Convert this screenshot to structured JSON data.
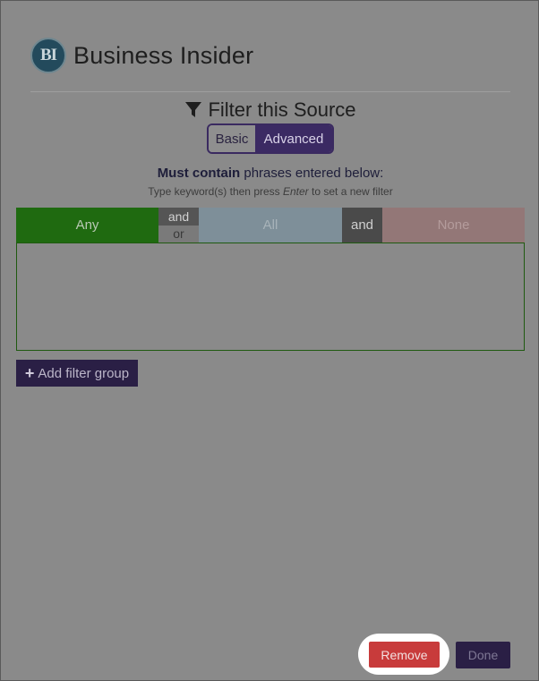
{
  "source": {
    "logo_text": "BI",
    "title": "Business Insider"
  },
  "filter": {
    "heading": "Filter this Source",
    "modes": {
      "basic": "Basic",
      "advanced": "Advanced",
      "selected": "Advanced"
    },
    "must_contain_bold": "Must contain",
    "must_contain_rest": " phrases entered below:",
    "hint_prefix": "Type keyword(s) then press ",
    "hint_key": "Enter",
    "hint_suffix": " to set a new filter"
  },
  "group": {
    "any": "Any",
    "and_label": "and",
    "or_label": "or",
    "all": "All",
    "and2": "and",
    "none": "None"
  },
  "actions": {
    "add_filter_group": "Add filter group",
    "remove": "Remove",
    "done": "Done"
  },
  "colors": {
    "any": "#1f6a10",
    "all": "#7e8f99",
    "none": "#937777",
    "accent": "#3b2a63",
    "remove": "#c83b3b"
  },
  "icons": {
    "filter": "funnel-icon",
    "add": "plus-icon"
  }
}
